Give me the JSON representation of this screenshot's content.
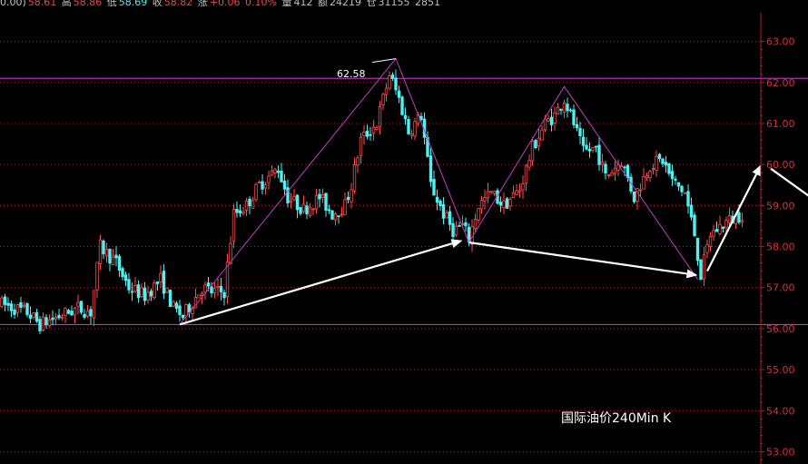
{
  "info_bar": {
    "open_fragment": "0.00)",
    "open_value": "58.61",
    "high_label": "高",
    "high_value": "58.86",
    "low_label": "低",
    "low_value": "58.69",
    "close_label": "收",
    "close_value": "58.82",
    "change_label": "涨",
    "change_value": "+0.06",
    "pct_value": "0.10%",
    "volume_label": "量",
    "volume_value": "412",
    "amount_label": "额",
    "amount_value": "24219",
    "position_label": "仓",
    "position_value": "31155",
    "extra_value": "2851"
  },
  "caption": "国际油价240Min K",
  "peak_label": "62.58",
  "colors": {
    "background": "#000000",
    "up_candle": "#ff4d4d",
    "down_candle": "#4ef0f0",
    "grid": "#b0202a",
    "axis_text": "#d93030",
    "support_resistance": "#d040d0",
    "zigzag": "#c040c0",
    "arrows": "#ffffff"
  },
  "chart_data": {
    "type": "candlestick",
    "title": "国际油价240Min K",
    "y_ticks": [
      "63.00",
      "62.00",
      "61.00",
      "60.00",
      "59.00",
      "58.00",
      "57.00",
      "56.00",
      "55.00",
      "54.00",
      "53.00"
    ],
    "ylim": [
      52.7,
      63.7
    ],
    "grid": true,
    "horizontal_levels": [
      62.1,
      56.1
    ],
    "annotations": [
      {
        "text": "62.58",
        "value": 62.58
      }
    ],
    "zigzag": [
      {
        "bar": 56,
        "price": 56.1
      },
      {
        "bar": 124,
        "price": 62.58
      },
      {
        "bar": 147,
        "price": 58.1
      },
      {
        "bar": 177,
        "price": 61.9
      },
      {
        "bar": 219,
        "price": 57.2
      }
    ],
    "arrows": [
      {
        "from": {
          "bar": 56,
          "price": 56.1
        },
        "to": {
          "bar": 145,
          "price": 58.15
        }
      },
      {
        "from": {
          "bar": 147,
          "price": 58.1
        },
        "to": {
          "bar": 219,
          "price": 57.3
        }
      },
      {
        "from": {
          "bar": 222,
          "price": 57.4
        },
        "to": {
          "bar": 239,
          "price": 60.0
        }
      },
      {
        "from": {
          "bar": 242,
          "price": 59.9
        },
        "to": {
          "bar": 260,
          "price": 58.9
        }
      }
    ],
    "bar_count_capacity": 242,
    "anchors": [
      [
        0,
        56.6
      ],
      [
        8,
        56.4
      ],
      [
        12,
        56.1
      ],
      [
        18,
        56.3
      ],
      [
        24,
        56.5
      ],
      [
        28,
        56.4
      ],
      [
        31,
        58.0
      ],
      [
        36,
        57.6
      ],
      [
        40,
        57.0
      ],
      [
        45,
        56.8
      ],
      [
        50,
        57.2
      ],
      [
        54,
        56.5
      ],
      [
        57,
        56.3
      ],
      [
        63,
        57.0
      ],
      [
        66,
        56.9
      ],
      [
        70,
        56.9
      ],
      [
        73,
        58.8
      ],
      [
        77,
        59.0
      ],
      [
        81,
        59.5
      ],
      [
        87,
        59.9
      ],
      [
        90,
        59.2
      ],
      [
        95,
        58.9
      ],
      [
        100,
        59.2
      ],
      [
        104,
        58.8
      ],
      [
        108,
        59.0
      ],
      [
        110,
        59.5
      ],
      [
        113,
        60.6
      ],
      [
        118,
        61.0
      ],
      [
        122,
        62.2
      ],
      [
        125,
        61.6
      ],
      [
        128,
        60.8
      ],
      [
        132,
        61.2
      ],
      [
        135,
        59.5
      ],
      [
        139,
        58.8
      ],
      [
        142,
        58.4
      ],
      [
        145,
        58.5
      ],
      [
        147,
        58.2
      ],
      [
        150,
        59.0
      ],
      [
        154,
        59.3
      ],
      [
        158,
        59.0
      ],
      [
        163,
        59.4
      ],
      [
        167,
        60.4
      ],
      [
        171,
        61.0
      ],
      [
        174,
        61.2
      ],
      [
        177,
        61.6
      ],
      [
        180,
        61.0
      ],
      [
        183,
        60.3
      ],
      [
        187,
        60.4
      ],
      [
        190,
        59.7
      ],
      [
        195,
        60.1
      ],
      [
        199,
        59.2
      ],
      [
        204,
        60.0
      ],
      [
        208,
        60.1
      ],
      [
        211,
        59.6
      ],
      [
        215,
        59.3
      ],
      [
        218,
        58.3
      ],
      [
        220,
        57.3
      ],
      [
        223,
        58.3
      ],
      [
        228,
        58.6
      ],
      [
        233,
        58.8
      ]
    ]
  }
}
